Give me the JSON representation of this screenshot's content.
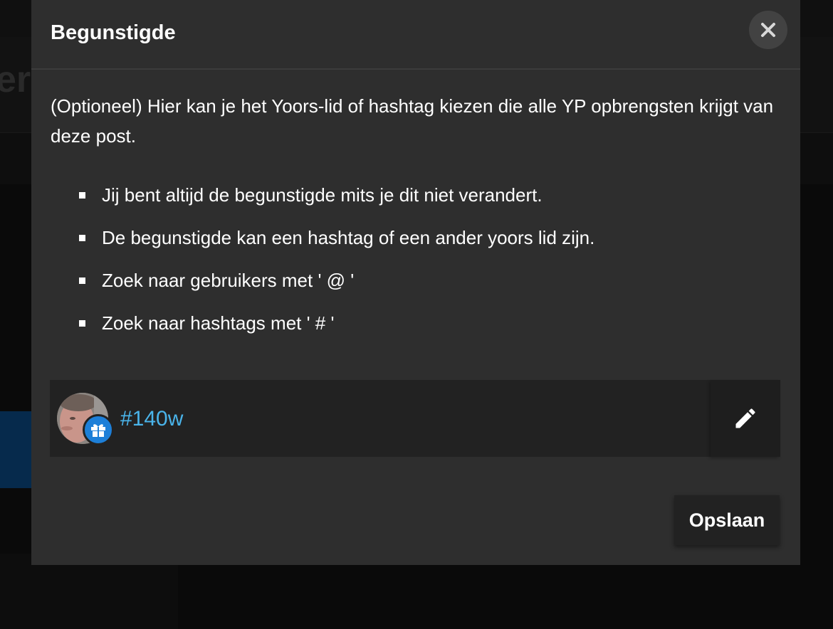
{
  "background": {
    "ghost_text": "er"
  },
  "modal": {
    "title": "Begunstigde",
    "close_icon": "close-icon",
    "intro": "(Optioneel) Hier kan je het Yoors-lid of hashtag kiezen die alle YP opbrengsten krijgt van deze post.",
    "rules": [
      "Jij bent altijd de begunstigde mits je dit niet verandert.",
      "De begunstigde kan een hashtag of een ander yoors lid zijn.",
      "Zoek naar gebruikers met ' @ '",
      "Zoek naar hashtags met ' # '"
    ],
    "beneficiary": {
      "name": "#140w",
      "badge_icon": "gift-icon",
      "edit_icon": "pencil-icon"
    },
    "save_label": "Opslaan"
  },
  "colors": {
    "modal_bg": "#2e2e2e",
    "row_bg": "#222222",
    "link": "#4ab4ea",
    "badge": "#1d7fd8"
  }
}
